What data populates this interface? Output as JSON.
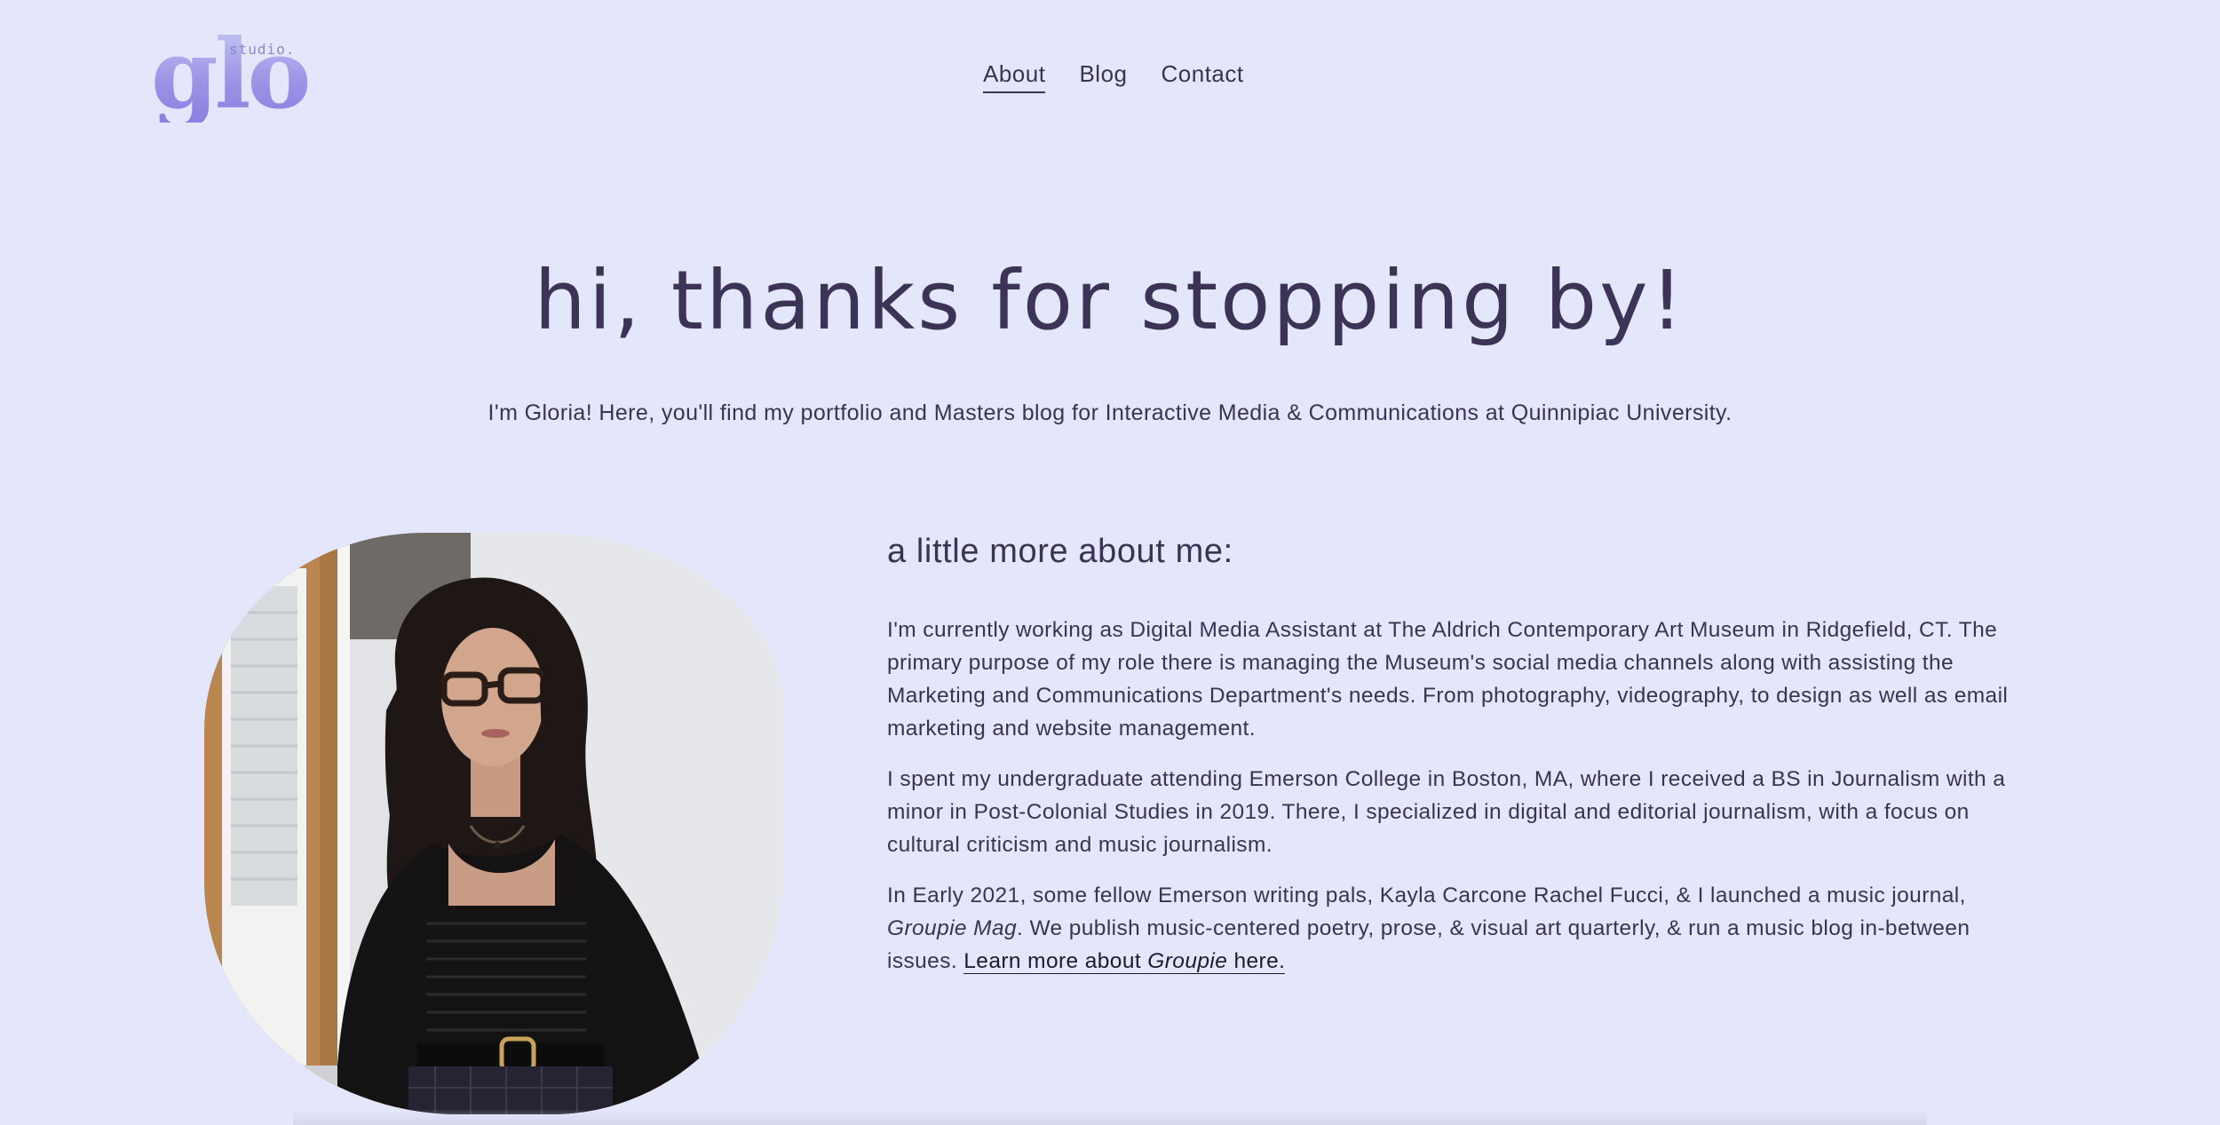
{
  "logo": {
    "wordmark": "glo",
    "suffix": "studio."
  },
  "nav": {
    "items": [
      {
        "label": "About",
        "active": true
      },
      {
        "label": "Blog",
        "active": false
      },
      {
        "label": "Contact",
        "active": false
      }
    ]
  },
  "hero": {
    "title": "hi, thanks for stopping by!",
    "subtitle": "I'm Gloria! Here, you'll find my portfolio and Masters blog for Interactive Media & Communications at Quinnipiac University."
  },
  "about": {
    "heading": "a little more about me:",
    "para1": "I'm currently working as Digital Media Assistant at The Aldrich Contemporary Art Museum in Ridgefield, CT. The primary purpose of my role there is managing the Museum's social media channels along with assisting the Marketing and Communications Department's needs. From photography, videography, to design as well as email marketing and website management.",
    "para2": "I spent my undergraduate attending Emerson College in Boston, MA, where I received a BS in Journalism with a minor in Post-Colonial Studies in 2019. There, I specialized in digital and editorial journalism, with a focus on cultural criticism and music journalism.",
    "para3": {
      "text_before": "In Early 2021, some fellow Emerson writing pals, Kayla Carcone Rachel Fucci, & I launched a music journal, ",
      "mag_name": "Groupie Mag",
      "text_after": ". We publish music-centered poetry, prose, & visual art quarterly, & run a music blog in-between issues. ",
      "link_before": "Learn more about ",
      "link_italic": "Groupie",
      "link_after": " here."
    }
  },
  "colors": {
    "background": "#e4e7fb",
    "text": "#3a3354",
    "logo_gradient_start": "#c3c5f2",
    "logo_gradient_end": "#8b7fe0"
  }
}
